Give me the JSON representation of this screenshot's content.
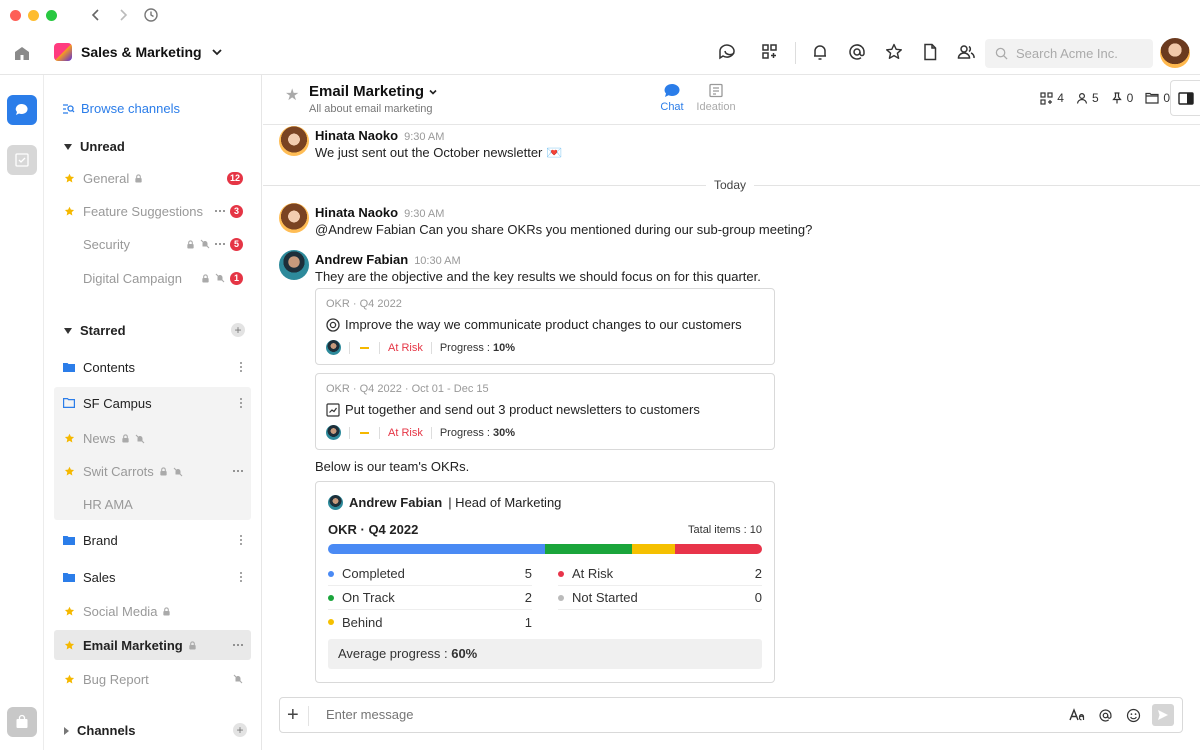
{
  "workspace": {
    "name": "Sales & Marketing"
  },
  "search": {
    "placeholder": "Search Acme Inc."
  },
  "sidebar": {
    "browse_label": "Browse channels",
    "unread": {
      "title": "Unread",
      "items": [
        {
          "label": "General",
          "badge": "12"
        },
        {
          "label": "Feature Suggestions",
          "badge": "3"
        },
        {
          "label": "Security",
          "badge": "5"
        },
        {
          "label": "Digital Campaign",
          "badge": "1"
        }
      ]
    },
    "starred": {
      "title": "Starred",
      "items": [
        {
          "label": "Contents"
        },
        {
          "label": "SF Campus"
        },
        {
          "label": "News"
        },
        {
          "label": "Swit Carrots"
        },
        {
          "label": "HR AMA"
        },
        {
          "label": "Brand"
        },
        {
          "label": "Sales"
        },
        {
          "label": "Social Media"
        },
        {
          "label": "Email Marketing"
        },
        {
          "label": "Bug Report"
        }
      ]
    },
    "channels_title": "Channels"
  },
  "channel": {
    "name": "Email Marketing",
    "description": "All about email marketing",
    "tabs": [
      {
        "label": "Chat"
      },
      {
        "label": "Ideation"
      }
    ],
    "stats": {
      "apps": "4",
      "members": "5",
      "pinned": "0",
      "files": "0"
    }
  },
  "messages": [
    {
      "author": "Hinata Naoko",
      "time": "9:30 AM",
      "text": "We just sent out the October newsletter 💌"
    },
    {
      "author": "Hinata Naoko",
      "time": "9:30 AM",
      "text": "@Andrew Fabian Can you share OKRs you mentioned during our sub-group meeting?"
    },
    {
      "author": "Andrew Fabian",
      "time": "10:30 AM",
      "text": "They are the objective and the key results we should focus on for this quarter."
    }
  ],
  "divider_label": "Today",
  "okr_cards": [
    {
      "meta": "OKR · Q4 2022",
      "title": "Improve the way we communicate product changes to our customers",
      "status": "At Risk",
      "progress_label": "Progress : ",
      "progress": "10%"
    },
    {
      "meta": "OKR · Q4 2022 · Oct 01 - Dec 15",
      "title": "Put together and send out 3 product newsletters to customers",
      "status": "At Risk",
      "progress_label": "Progress : ",
      "progress": "30%"
    }
  ],
  "followup_text": "Below is our team's OKRs.",
  "okr_summary": {
    "owner": "Andrew Fabian",
    "role": "| Head of Marketing",
    "title": "OKR · Q4 2022",
    "total_label": "Tatal items : 10",
    "items": [
      {
        "label": "Completed",
        "count": "5",
        "color": "#4a8af4"
      },
      {
        "label": "On Track",
        "count": "2",
        "color": "#1aa53b"
      },
      {
        "label": "Behind",
        "count": "1",
        "color": "#f5c000"
      },
      {
        "label": "At Risk",
        "count": "2",
        "color": "#e8344a"
      },
      {
        "label": "Not Started",
        "count": "0",
        "color": "#bbbbbb"
      }
    ],
    "avg_label": "Average progress : ",
    "avg_value": "60%"
  },
  "composer": {
    "placeholder": "Enter message"
  },
  "colors": {
    "accent": "#2b7de9",
    "badge": "#e53545",
    "star": "#f5b800"
  }
}
